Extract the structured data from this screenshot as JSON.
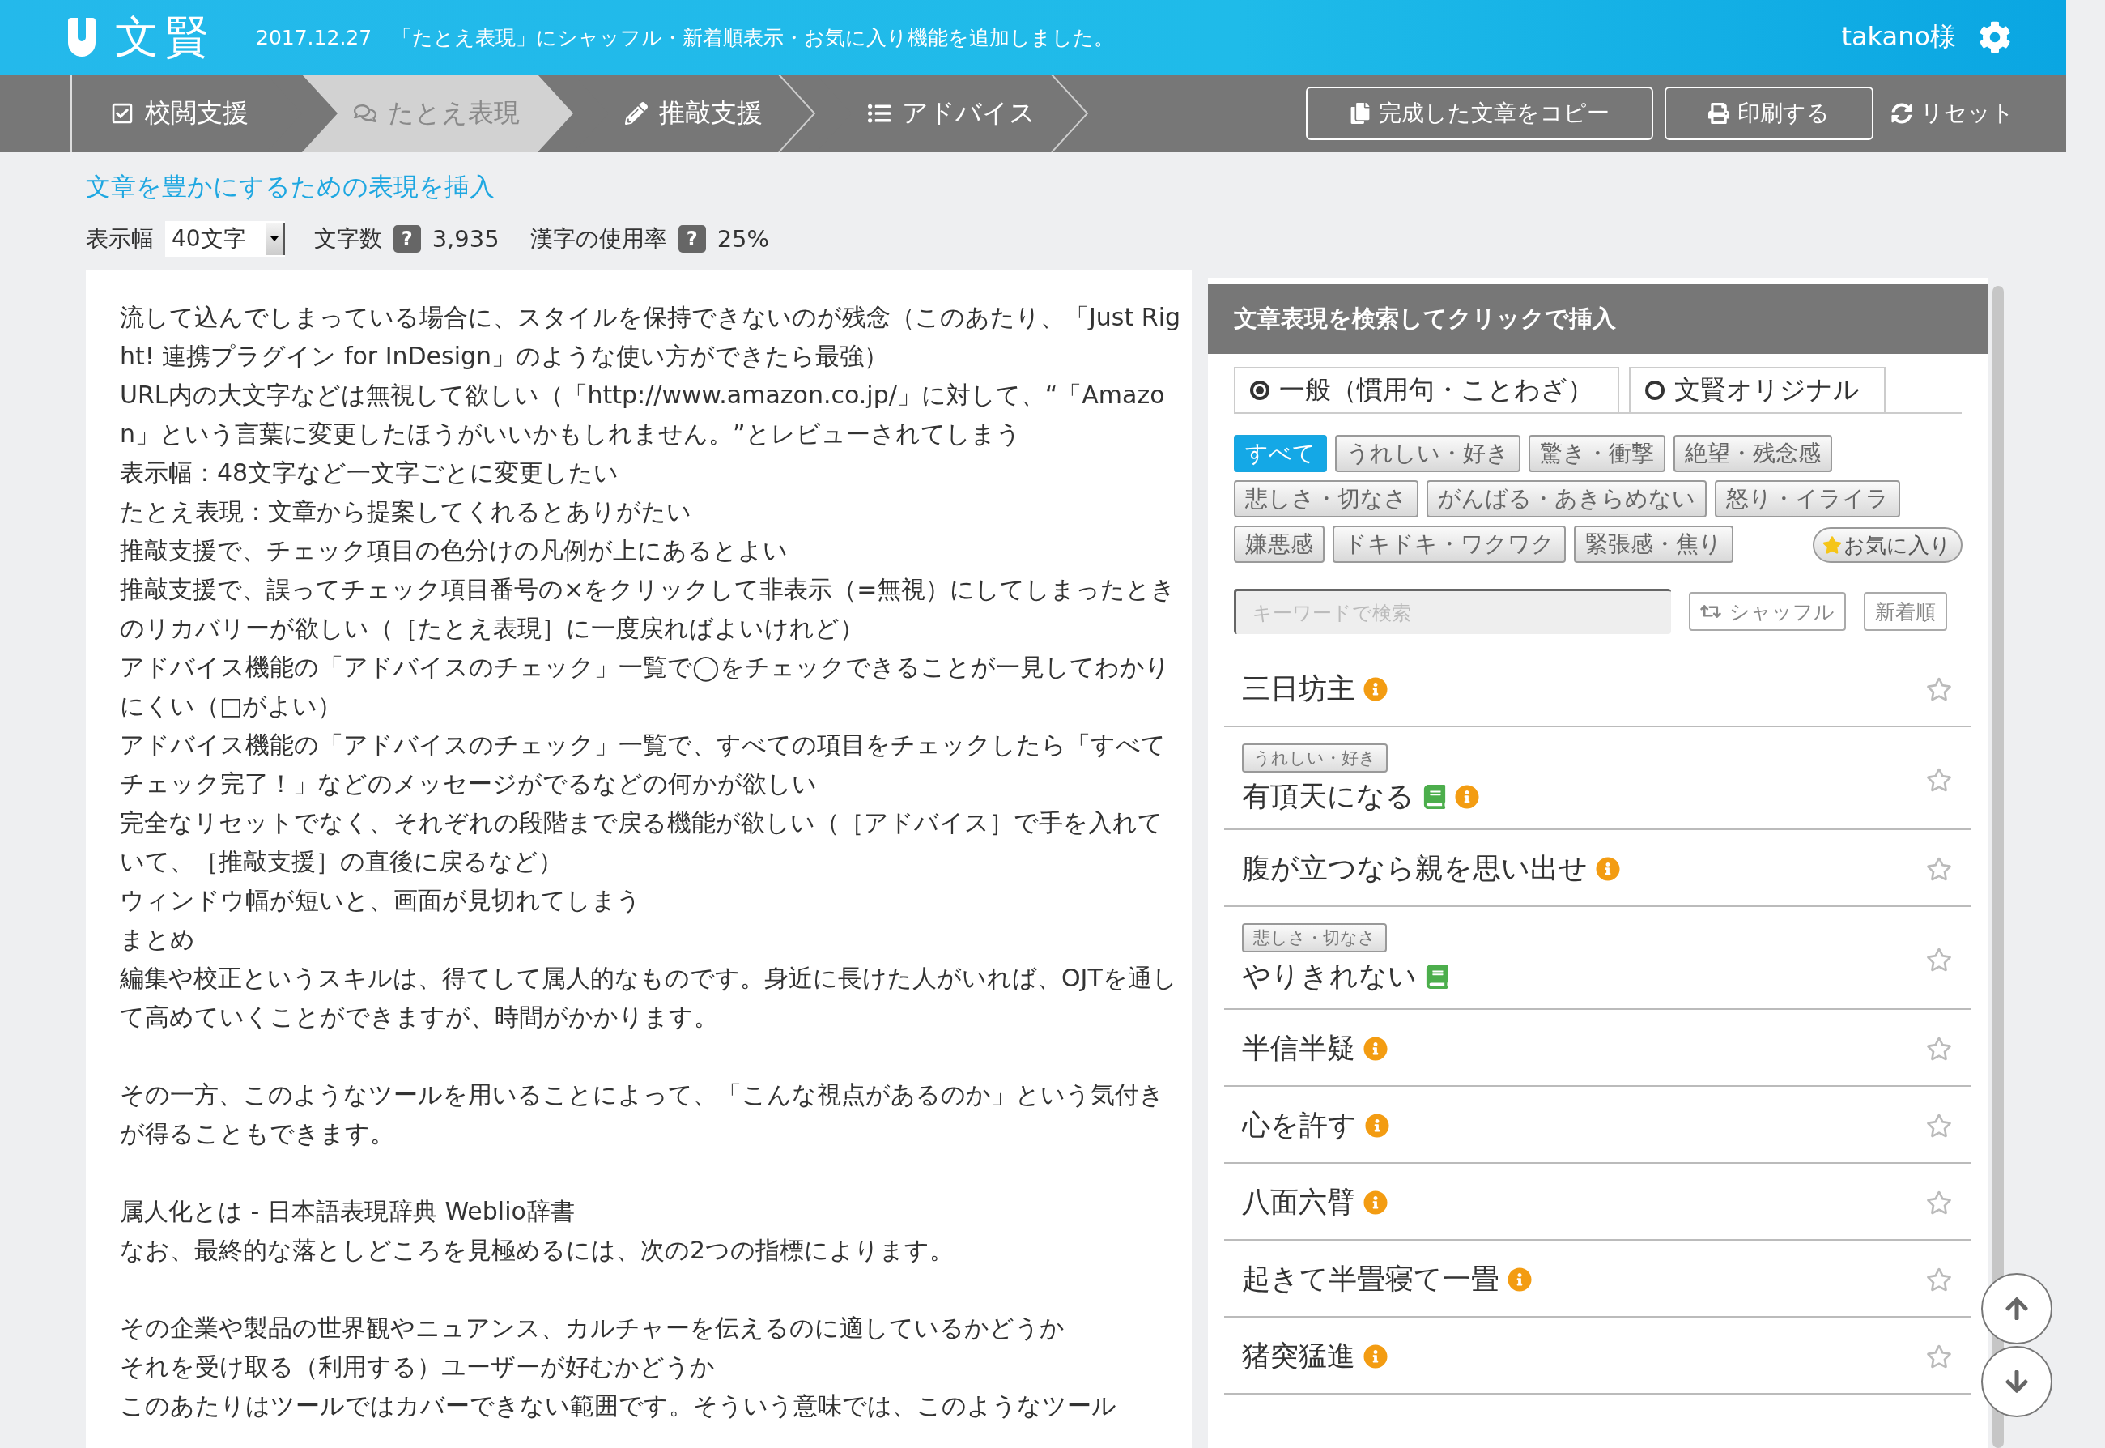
{
  "header": {
    "logo_text": "文賢",
    "announcement": "2017.12.27　「たとえ表現」にシャッフル・新着順表示・お気に入り機能を追加しました。",
    "user": "takano様"
  },
  "steps": [
    {
      "label": "校閲支援",
      "selected": false
    },
    {
      "label": "たとえ表現",
      "selected": true
    },
    {
      "label": "推敲支援",
      "selected": false
    },
    {
      "label": "アドバイス",
      "selected": false
    }
  ],
  "actions": [
    {
      "label": "完成した文章をコピー",
      "kind": "outlined"
    },
    {
      "label": "印刷する",
      "kind": "outlined"
    },
    {
      "label": "リセット",
      "kind": "plain"
    }
  ],
  "heading": "文章を豊かにするための表現を挿入",
  "toolbar": {
    "width_label": "表示幅",
    "width_value": "40文字",
    "char_count_label": "文字数",
    "char_count_help": "?",
    "char_count": "3,935",
    "kanji_label": "漢字の使用率",
    "kanji_help": "?",
    "kanji_rate": "25%"
  },
  "document": [
    [
      "流して込んでしまっている場合に、スタイルを保持できないのが残念（このあたり、「Just Right! 連携プラグイン for InDesign」のような使い方ができたら最強）",
      "URL内の大文字などは無視して欲しい（「http://www.amazon.co.jp/」に対して、“「Amazon」という言葉に変更したほうがいいかもしれません。”とレビューされてしまう",
      "表示幅：48文字など一文字ごとに変更したい",
      "たとえ表現：文章から提案してくれるとありがたい",
      "推敲支援で、チェック項目の色分けの凡例が上にあるとよい",
      "推敲支援で、誤ってチェック項目番号の×をクリックして非表示（=無視）にしてしまったときのリカバリーが欲しい（［たとえ表現］に一度戻ればよいけれど）",
      "アドバイス機能の「アドバイスのチェック」一覧で◯をチェックできることが一見してわかりにくい（□がよい）",
      "アドバイス機能の「アドバイスのチェック」一覧で、すべての項目をチェックしたら「すべてチェック完了！」などのメッセージがでるなどの何かが欲しい",
      "完全なリセットでなく、それぞれの段階まで戻る機能が欲しい（［アドバイス］で手を入れていて、［推敲支援］の直後に戻るなど）",
      "ウィンドウ幅が短いと、画面が見切れてしまう",
      "まとめ",
      "編集や校正というスキルは、得てして属人的なものです。身近に長けた人がいれば、OJTを通して高めていくことができますが、時間がかかります。"
    ],
    [
      "その一方、このようなツールを用いることによって、「こんな視点があるのか」という気付きが得ることもできます。"
    ],
    [
      "属人化とは - 日本語表現辞典 Weblio辞書",
      "なお、最終的な落としどころを見極めるには、次の2つの指標によります。"
    ],
    [
      "その企業や製品の世界観やニュアンス、カルチャーを伝えるのに適しているかどうか",
      "それを受け取る（利用する）ユーザーが好むかどうか",
      "このあたりはツールではカバーできない範囲です。そういう意味では、このようなツール"
    ]
  ],
  "panel": {
    "title": "文章表現を検索してクリックで挿入",
    "sources": [
      {
        "label": "一般（慣用句・ことわざ）",
        "selected": true
      },
      {
        "label": "文賢オリジナル",
        "selected": false
      }
    ],
    "categories": [
      {
        "label": "すべて",
        "selected": true
      },
      {
        "label": "うれしい・好き",
        "selected": false
      },
      {
        "label": "驚き・衝撃",
        "selected": false
      },
      {
        "label": "絶望・残念感",
        "selected": false
      },
      {
        "label": "悲しさ・切なさ",
        "selected": false
      },
      {
        "label": "がんばる・あきらめない",
        "selected": false
      },
      {
        "label": "怒り・イライラ",
        "selected": false
      },
      {
        "label": "嫌悪感",
        "selected": false
      },
      {
        "label": "ドキドキ・ワクワク",
        "selected": false
      },
      {
        "label": "緊張感・焦り",
        "selected": false
      }
    ],
    "favorites": "お気に入り",
    "search_placeholder": "キーワードで検索",
    "shuffle": "シャッフル",
    "newest": "新着順",
    "expressions": [
      {
        "text": "三日坊主",
        "book": false,
        "info": true,
        "favorite": false
      },
      {
        "tag": "うれしい・好き",
        "text": "有頂天になる",
        "book": true,
        "info": true,
        "favorite": false
      },
      {
        "text": "腹が立つなら親を思い出せ",
        "book": false,
        "info": true,
        "favorite": false
      },
      {
        "tag": "悲しさ・切なさ",
        "text": "やりきれない",
        "book": true,
        "info": false,
        "favorite": false
      },
      {
        "text": "半信半疑",
        "book": false,
        "info": true,
        "favorite": false
      },
      {
        "text": "心を許す",
        "book": false,
        "info": true,
        "favorite": false
      },
      {
        "text": "八面六臂",
        "book": false,
        "info": true,
        "favorite": false
      },
      {
        "text": "起きて半畳寝て一畳",
        "book": false,
        "info": true,
        "favorite": false
      },
      {
        "text": "猪突猛進",
        "book": false,
        "info": true,
        "favorite": false
      }
    ]
  }
}
